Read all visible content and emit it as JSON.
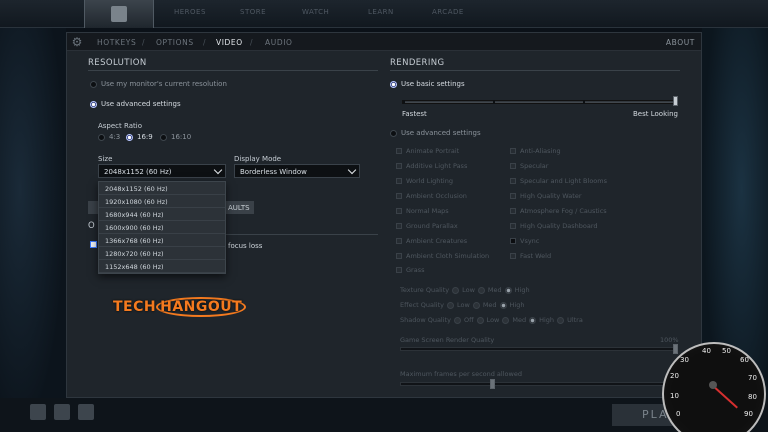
{
  "topbar": {
    "nav": [
      "HEROES",
      "STORE",
      "WATCH",
      "LEARN",
      "ARCADE"
    ]
  },
  "tabs": {
    "items": [
      "HOTKEYS",
      "OPTIONS",
      "VIDEO",
      "AUDIO"
    ],
    "active": "VIDEO",
    "about": "ABOUT"
  },
  "resolution": {
    "title": "RESOLUTION",
    "use_monitor": "Use my monitor's current resolution",
    "use_advanced": "Use advanced settings",
    "aspect_label": "Aspect Ratio",
    "aspect_options": [
      "4:3",
      "16:9",
      "16:10"
    ],
    "aspect_selected": "16:9",
    "size_label": "Size",
    "size_value": "2048x1152 (60 Hz)",
    "size_options": [
      "2048x1152 (60 Hz)",
      "1920x1080 (60 Hz)",
      "1680x944 (60 Hz)",
      "1600x900 (60 Hz)",
      "1366x768 (60 Hz)",
      "1280x720 (60 Hz)",
      "1152x648 (60 Hz)"
    ],
    "display_mode_label": "Display Mode",
    "display_mode_value": "Borderless Window",
    "defaults_partial": "AULTS",
    "other_partial": "O",
    "focus_loss": "focus loss"
  },
  "rendering": {
    "title": "RENDERING",
    "use_basic": "Use basic settings",
    "fastest": "Fastest",
    "best_looking": "Best Looking",
    "basic_level": 1.0,
    "use_advanced": "Use advanced settings",
    "left_options": [
      "Animate Portrait",
      "Additive Light Pass",
      "World Lighting",
      "Ambient Occlusion",
      "Normal Maps",
      "Ground Parallax",
      "Ambient Creatures",
      "Ambient Cloth Simulation",
      "Grass"
    ],
    "right_options": [
      "Anti-Aliasing",
      "Specular",
      "Specular and Light Blooms",
      "High Quality Water",
      "Atmosphere Fog / Caustics",
      "High Quality Dashboard",
      "Vsync",
      "Fast Weld"
    ],
    "texture_quality": {
      "label": "Texture Quality",
      "options": [
        "Low",
        "Med",
        "High"
      ]
    },
    "effect_quality": {
      "label": "Effect Quality",
      "options": [
        "Low",
        "Med",
        "High"
      ]
    },
    "shadow_quality": {
      "label": "Shadow Quality",
      "options": [
        "Off",
        "Low",
        "Med",
        "High",
        "Ultra"
      ]
    },
    "render_quality_label": "Game Screen Render Quality",
    "render_quality_value": "100%",
    "fps_label": "Maximum frames per second allowed"
  },
  "watermark": {
    "brand": "TECHHANGOUT"
  },
  "gauge": {
    "ticks": [
      "0",
      "10",
      "20",
      "30",
      "40",
      "50",
      "60",
      "70",
      "80",
      "90"
    ]
  },
  "play": {
    "label": "PLA"
  }
}
